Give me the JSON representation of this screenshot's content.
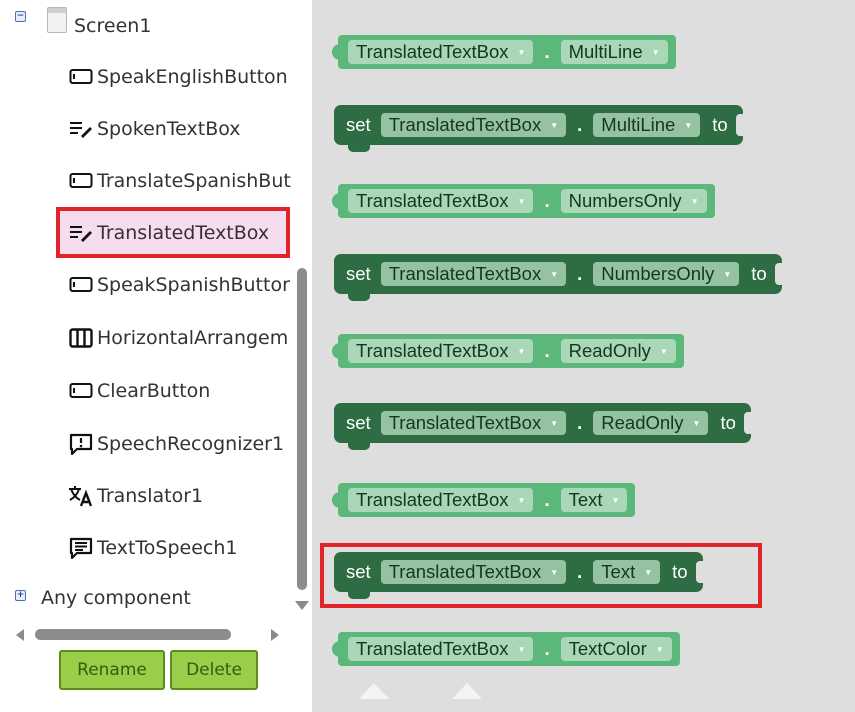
{
  "tree": {
    "screen_label": "Screen1",
    "items": [
      {
        "label": "SpeakEnglishButton",
        "icon": "button-icon"
      },
      {
        "label": "SpokenTextBox",
        "icon": "textbox-icon"
      },
      {
        "label": "TranslateSpanishBut",
        "icon": "button-icon"
      },
      {
        "label": "TranslatedTextBox",
        "icon": "textbox-icon",
        "selected": true
      },
      {
        "label": "SpeakSpanishButtor",
        "icon": "button-icon"
      },
      {
        "label": "HorizontalArrangem",
        "icon": "horizontal-arrangement-icon"
      },
      {
        "label": "ClearButton",
        "icon": "button-icon"
      },
      {
        "label": "SpeechRecognizer1",
        "icon": "speech-recognizer-icon"
      },
      {
        "label": "Translator1",
        "icon": "translator-icon"
      },
      {
        "label": "TextToSpeech1",
        "icon": "text-to-speech-icon"
      }
    ],
    "any_component_label": "Any component",
    "rename_label": "Rename",
    "delete_label": "Delete"
  },
  "blocks": [
    {
      "kind": "getter",
      "component": "TranslatedTextBox",
      "property": "MultiLine"
    },
    {
      "kind": "setter",
      "set": "set",
      "component": "TranslatedTextBox",
      "property": "MultiLine",
      "to": "to"
    },
    {
      "kind": "getter",
      "component": "TranslatedTextBox",
      "property": "NumbersOnly"
    },
    {
      "kind": "setter",
      "set": "set",
      "component": "TranslatedTextBox",
      "property": "NumbersOnly",
      "to": "to"
    },
    {
      "kind": "getter",
      "component": "TranslatedTextBox",
      "property": "ReadOnly"
    },
    {
      "kind": "setter",
      "set": "set",
      "component": "TranslatedTextBox",
      "property": "ReadOnly",
      "to": "to"
    },
    {
      "kind": "getter",
      "component": "TranslatedTextBox",
      "property": "Text"
    },
    {
      "kind": "setter",
      "set": "set",
      "component": "TranslatedTextBox",
      "property": "Text",
      "to": "to",
      "highlighted": true
    },
    {
      "kind": "getter",
      "component": "TranslatedTextBox",
      "property": "TextColor"
    }
  ],
  "colors": {
    "getter_block": "#5bb87a",
    "setter_block": "#2e6d43",
    "highlight": "#e1232a",
    "button": "#9acd48",
    "selected_row": "#f6dcef"
  }
}
